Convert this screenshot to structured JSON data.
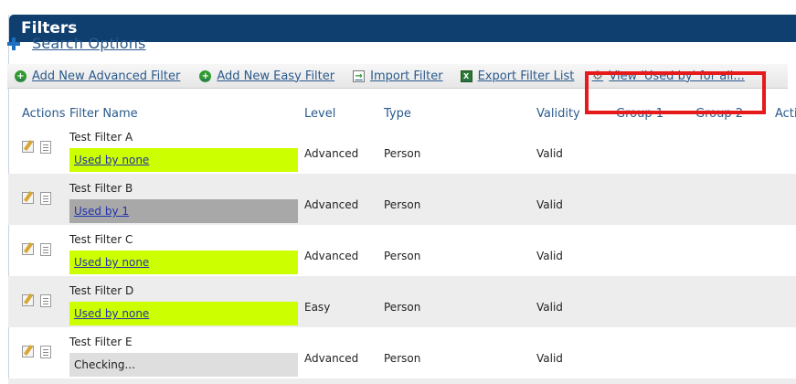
{
  "panel": {
    "title": "Filters"
  },
  "search": {
    "label": "Search Options"
  },
  "toolbar": {
    "add_advanced": "Add New Advanced Filter",
    "add_easy": "Add New Easy Filter",
    "import": "Import Filter",
    "export": "Export Filter List",
    "view_used_by": "View 'Used by' for all..."
  },
  "columns": {
    "actions": "Actions",
    "filter_name": "Filter Name",
    "level": "Level",
    "type": "Type",
    "validity": "Validity",
    "group1": "Group 1",
    "group2": "Group 2",
    "actions2": "Acti"
  },
  "rows": [
    {
      "name": "Test Filter A",
      "used_by": "Used by none",
      "level": "Advanced",
      "type": "Person",
      "validity": "Valid"
    },
    {
      "name": "Test Filter B",
      "used_by": "Used by 1",
      "level": "Advanced",
      "type": "Person",
      "validity": "Valid"
    },
    {
      "name": "Test Filter C",
      "used_by": "Used by none",
      "level": "Advanced",
      "type": "Person",
      "validity": "Valid"
    },
    {
      "name": "Test Filter D",
      "used_by": "Used by none",
      "level": "Easy",
      "type": "Person",
      "validity": "Valid"
    },
    {
      "name": "Test Filter E",
      "used_by": "Checking...",
      "level": "Advanced",
      "type": "Person",
      "validity": "Valid"
    }
  ],
  "colors": {
    "header_bg": "#0f3f6f",
    "used_none": "#ccff00",
    "used_some": "#a8a8a8",
    "highlight": "#e61a1a"
  }
}
